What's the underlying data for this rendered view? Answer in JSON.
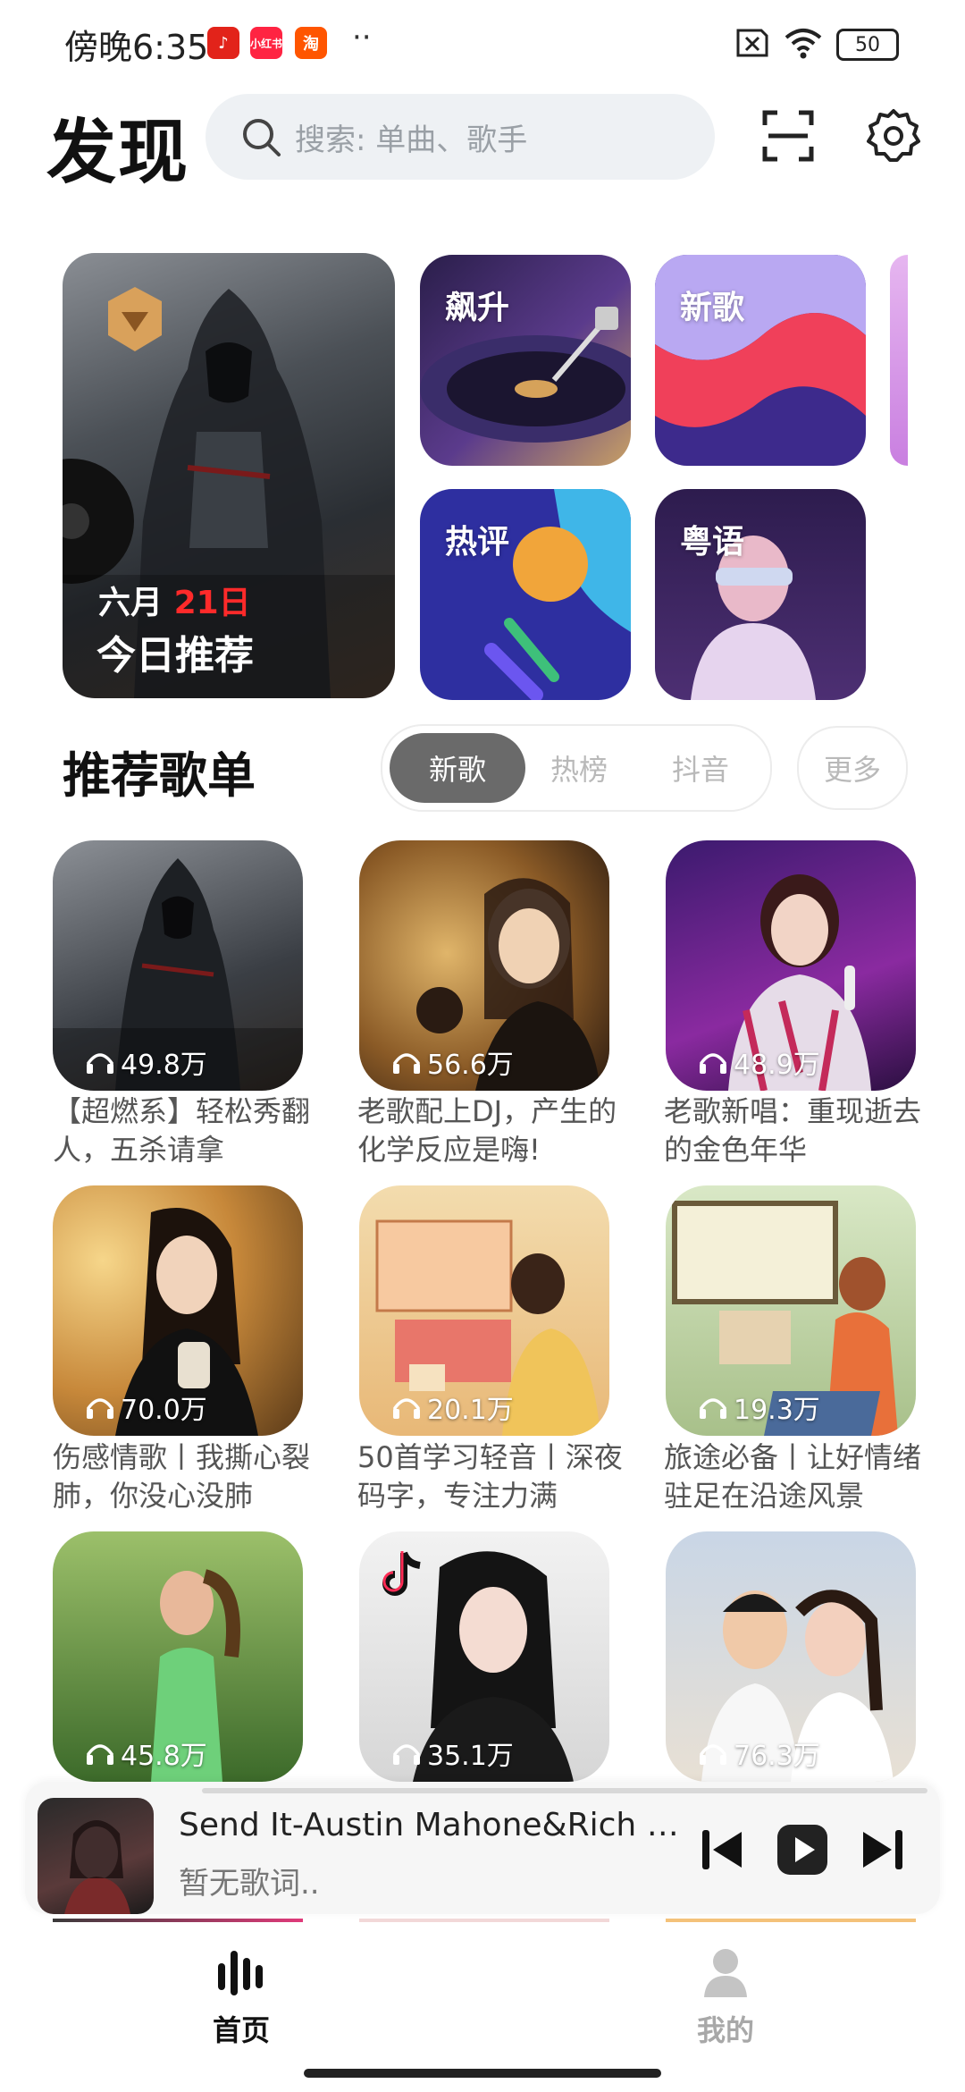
{
  "status_bar": {
    "time": "傍晚6:35",
    "app_icons": [
      "music-app-icon",
      "xiaohongshu-icon",
      "taobao-icon"
    ],
    "more_dots": "··",
    "battery": "50"
  },
  "header": {
    "title": "发现",
    "search_placeholder": "搜索: 单曲、歌手"
  },
  "hero": {
    "daily": {
      "month": "六月",
      "day": "21日",
      "label": "今日推荐"
    },
    "tiles": [
      {
        "label": "飙升"
      },
      {
        "label": "新歌"
      },
      {
        "label": "热评"
      },
      {
        "label": "粤语"
      }
    ]
  },
  "playlists": {
    "section_title": "推荐歌单",
    "tabs": [
      "新歌",
      "热榜",
      "抖音"
    ],
    "active_tab": "新歌",
    "more_label": "更多",
    "items": [
      {
        "count": "49.8万",
        "title": "【超燃系】轻松秀翻人，五杀请拿"
      },
      {
        "count": "56.6万",
        "title": "老歌配上DJ，产生的化学反应是嗨!"
      },
      {
        "count": "48.9万",
        "title": "老歌新唱：重现逝去的金色年华"
      },
      {
        "count": "70.0万",
        "title": "伤感情歌丨我撕心裂肺，你没心没肺"
      },
      {
        "count": "20.1万",
        "title": "50首学习轻音丨深夜码字，专注力满"
      },
      {
        "count": "19.3万",
        "title": "旅途必备丨让好情绪驻足在沿途风景"
      },
      {
        "count": "45.8万",
        "title": ""
      },
      {
        "count": "35.1万",
        "title": ""
      },
      {
        "count": "76.3万",
        "title": ""
      }
    ]
  },
  "player": {
    "song": "Send It-Austin Mahone&Rich Ho...",
    "lyric": "暂无歌词..",
    "progress": 0.0
  },
  "bottom_nav": {
    "items": [
      {
        "label": "首页",
        "icon": "equalizer-icon",
        "active": true
      },
      {
        "label": "我的",
        "icon": "person-icon",
        "active": false
      }
    ]
  }
}
